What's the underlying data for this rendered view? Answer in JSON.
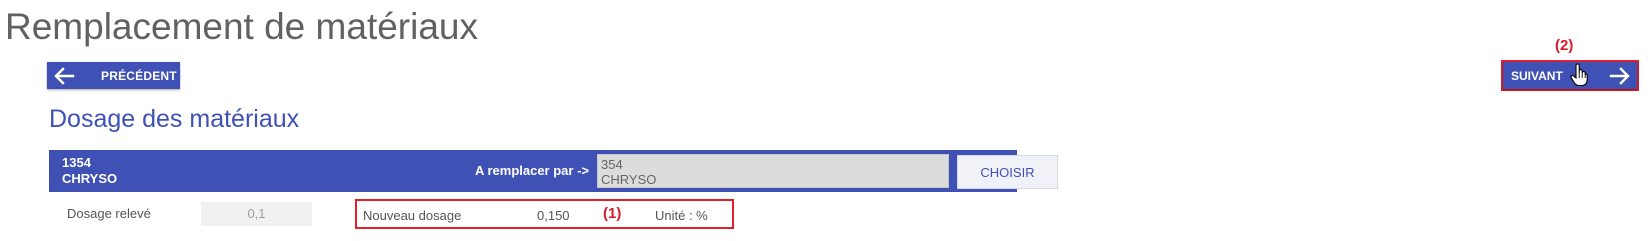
{
  "page": {
    "title": "Remplacement de matériaux",
    "section_title": "Dosage des matériaux"
  },
  "nav": {
    "prev_label": "PRÉCÉDENT",
    "next_label": "SUIVANT"
  },
  "annotations": {
    "marker_1": "(1)",
    "marker_2": "(2)",
    "highlight_color": "#e0202a"
  },
  "material": {
    "current_code": "1354",
    "current_name": "CHRYSO",
    "replace_label": "A remplacer par ->",
    "replacement_code": "354",
    "replacement_name": "CHRYSO",
    "choose_label": "CHOISIR"
  },
  "dosage": {
    "measured_label": "Dosage relevé",
    "measured_value": "0,1",
    "new_label": "Nouveau dosage",
    "new_value": "0,150",
    "unit_text": "Unité : %"
  },
  "colors": {
    "primary": "#3f51b5",
    "title_gray": "#616161"
  }
}
